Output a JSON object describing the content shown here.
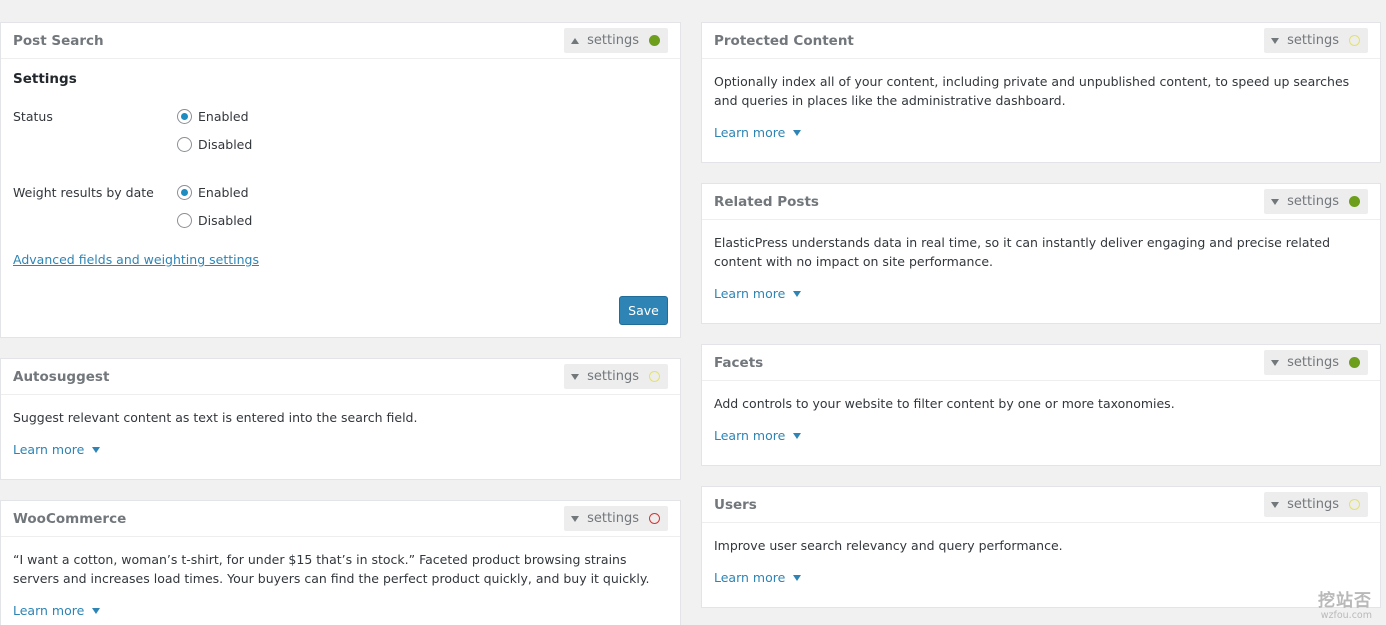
{
  "settings_label": "settings",
  "learn_more_label": "Learn more",
  "status_colors": {
    "active": "#6d9e1c",
    "available": "#e4e45e",
    "error": "#dc3232"
  },
  "post_search": {
    "title": "Post Search",
    "settings_expanded": true,
    "status": "active",
    "section_title": "Settings",
    "status_label": "Status",
    "weight_label": "Weight results by date",
    "enabled_label": "Enabled",
    "disabled_label": "Disabled",
    "status_value": "Enabled",
    "weight_value": "Enabled",
    "advanced_link": "Advanced fields and weighting settings",
    "save_label": "Save"
  },
  "autosuggest": {
    "title": "Autosuggest",
    "status": "available",
    "description": "Suggest relevant content as text is entered into the search field."
  },
  "woocommerce": {
    "title": "WooCommerce",
    "status": "error",
    "description": "“I want a cotton, woman’s t-shirt, for under $15 that’s in stock.” Faceted product browsing strains servers and increases load times. Your buyers can find the perfect product quickly, and buy it quickly."
  },
  "protected_content": {
    "title": "Protected Content",
    "status": "available",
    "description": "Optionally index all of your content, including private and unpublished content, to speed up searches and queries in places like the administrative dashboard."
  },
  "related_posts": {
    "title": "Related Posts",
    "status": "active",
    "description": "ElasticPress understands data in real time, so it can instantly deliver engaging and precise related content with no impact on site performance."
  },
  "facets": {
    "title": "Facets",
    "status": "active",
    "description": "Add controls to your website to filter content by one or more taxonomies."
  },
  "users": {
    "title": "Users",
    "status": "available",
    "description": "Improve user search relevancy and query performance."
  },
  "watermark": {
    "main": "挖站否",
    "sub": "wzfou.com"
  }
}
